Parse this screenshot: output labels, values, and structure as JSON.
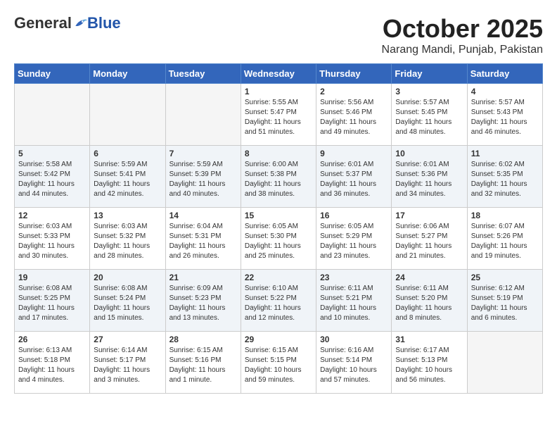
{
  "header": {
    "logo_general": "General",
    "logo_blue": "Blue",
    "month_title": "October 2025",
    "location": "Narang Mandi, Punjab, Pakistan"
  },
  "weekdays": [
    "Sunday",
    "Monday",
    "Tuesday",
    "Wednesday",
    "Thursday",
    "Friday",
    "Saturday"
  ],
  "weeks": [
    [
      {
        "day": "",
        "info": ""
      },
      {
        "day": "",
        "info": ""
      },
      {
        "day": "",
        "info": ""
      },
      {
        "day": "1",
        "info": "Sunrise: 5:55 AM\nSunset: 5:47 PM\nDaylight: 11 hours\nand 51 minutes."
      },
      {
        "day": "2",
        "info": "Sunrise: 5:56 AM\nSunset: 5:46 PM\nDaylight: 11 hours\nand 49 minutes."
      },
      {
        "day": "3",
        "info": "Sunrise: 5:57 AM\nSunset: 5:45 PM\nDaylight: 11 hours\nand 48 minutes."
      },
      {
        "day": "4",
        "info": "Sunrise: 5:57 AM\nSunset: 5:43 PM\nDaylight: 11 hours\nand 46 minutes."
      }
    ],
    [
      {
        "day": "5",
        "info": "Sunrise: 5:58 AM\nSunset: 5:42 PM\nDaylight: 11 hours\nand 44 minutes."
      },
      {
        "day": "6",
        "info": "Sunrise: 5:59 AM\nSunset: 5:41 PM\nDaylight: 11 hours\nand 42 minutes."
      },
      {
        "day": "7",
        "info": "Sunrise: 5:59 AM\nSunset: 5:39 PM\nDaylight: 11 hours\nand 40 minutes."
      },
      {
        "day": "8",
        "info": "Sunrise: 6:00 AM\nSunset: 5:38 PM\nDaylight: 11 hours\nand 38 minutes."
      },
      {
        "day": "9",
        "info": "Sunrise: 6:01 AM\nSunset: 5:37 PM\nDaylight: 11 hours\nand 36 minutes."
      },
      {
        "day": "10",
        "info": "Sunrise: 6:01 AM\nSunset: 5:36 PM\nDaylight: 11 hours\nand 34 minutes."
      },
      {
        "day": "11",
        "info": "Sunrise: 6:02 AM\nSunset: 5:35 PM\nDaylight: 11 hours\nand 32 minutes."
      }
    ],
    [
      {
        "day": "12",
        "info": "Sunrise: 6:03 AM\nSunset: 5:33 PM\nDaylight: 11 hours\nand 30 minutes."
      },
      {
        "day": "13",
        "info": "Sunrise: 6:03 AM\nSunset: 5:32 PM\nDaylight: 11 hours\nand 28 minutes."
      },
      {
        "day": "14",
        "info": "Sunrise: 6:04 AM\nSunset: 5:31 PM\nDaylight: 11 hours\nand 26 minutes."
      },
      {
        "day": "15",
        "info": "Sunrise: 6:05 AM\nSunset: 5:30 PM\nDaylight: 11 hours\nand 25 minutes."
      },
      {
        "day": "16",
        "info": "Sunrise: 6:05 AM\nSunset: 5:29 PM\nDaylight: 11 hours\nand 23 minutes."
      },
      {
        "day": "17",
        "info": "Sunrise: 6:06 AM\nSunset: 5:27 PM\nDaylight: 11 hours\nand 21 minutes."
      },
      {
        "day": "18",
        "info": "Sunrise: 6:07 AM\nSunset: 5:26 PM\nDaylight: 11 hours\nand 19 minutes."
      }
    ],
    [
      {
        "day": "19",
        "info": "Sunrise: 6:08 AM\nSunset: 5:25 PM\nDaylight: 11 hours\nand 17 minutes."
      },
      {
        "day": "20",
        "info": "Sunrise: 6:08 AM\nSunset: 5:24 PM\nDaylight: 11 hours\nand 15 minutes."
      },
      {
        "day": "21",
        "info": "Sunrise: 6:09 AM\nSunset: 5:23 PM\nDaylight: 11 hours\nand 13 minutes."
      },
      {
        "day": "22",
        "info": "Sunrise: 6:10 AM\nSunset: 5:22 PM\nDaylight: 11 hours\nand 12 minutes."
      },
      {
        "day": "23",
        "info": "Sunrise: 6:11 AM\nSunset: 5:21 PM\nDaylight: 11 hours\nand 10 minutes."
      },
      {
        "day": "24",
        "info": "Sunrise: 6:11 AM\nSunset: 5:20 PM\nDaylight: 11 hours\nand 8 minutes."
      },
      {
        "day": "25",
        "info": "Sunrise: 6:12 AM\nSunset: 5:19 PM\nDaylight: 11 hours\nand 6 minutes."
      }
    ],
    [
      {
        "day": "26",
        "info": "Sunrise: 6:13 AM\nSunset: 5:18 PM\nDaylight: 11 hours\nand 4 minutes."
      },
      {
        "day": "27",
        "info": "Sunrise: 6:14 AM\nSunset: 5:17 PM\nDaylight: 11 hours\nand 3 minutes."
      },
      {
        "day": "28",
        "info": "Sunrise: 6:15 AM\nSunset: 5:16 PM\nDaylight: 11 hours\nand 1 minute."
      },
      {
        "day": "29",
        "info": "Sunrise: 6:15 AM\nSunset: 5:15 PM\nDaylight: 10 hours\nand 59 minutes."
      },
      {
        "day": "30",
        "info": "Sunrise: 6:16 AM\nSunset: 5:14 PM\nDaylight: 10 hours\nand 57 minutes."
      },
      {
        "day": "31",
        "info": "Sunrise: 6:17 AM\nSunset: 5:13 PM\nDaylight: 10 hours\nand 56 minutes."
      },
      {
        "day": "",
        "info": ""
      }
    ]
  ]
}
